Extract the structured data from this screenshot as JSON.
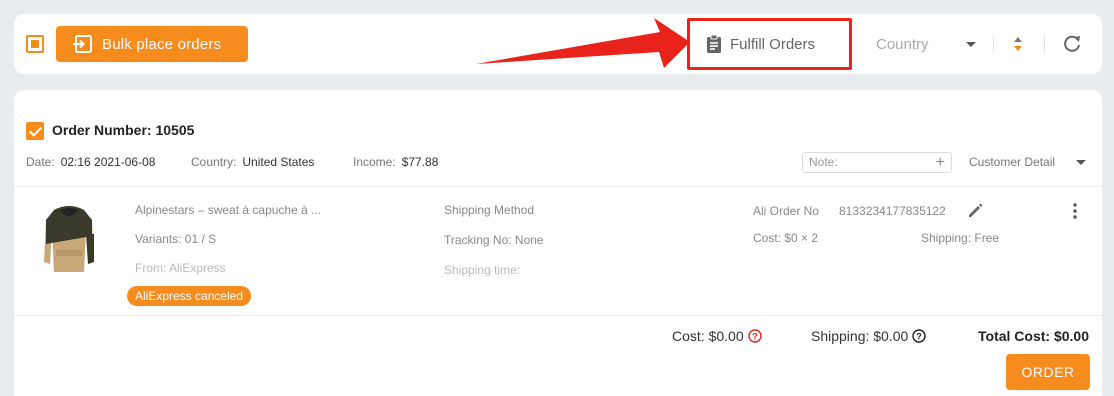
{
  "toolbar": {
    "bulk_label": "Bulk place orders",
    "fulfill_label": "Fulfill Orders",
    "country_placeholder": "Country"
  },
  "order": {
    "number_label": "Order Number: 10505",
    "date_key": "Date:",
    "date_value": "02:16 2021-06-08",
    "country_key": "Country:",
    "country_value": "United States",
    "income_key": "Income:",
    "income_value": "$77.88",
    "note_placeholder": "Note:",
    "customer_detail": "Customer Detail",
    "item": {
      "title": "Alpinestars – sweat à capuche à ...",
      "variants": "Variants: 01 / S",
      "from": "From: AliExpress",
      "status_badge": "AliExpress canceled",
      "shipping_method": "Shipping Method",
      "tracking": "Tracking No: None",
      "shipping_time": "Shipping time:",
      "ali_order_label": "Ali Order No",
      "ali_order_number": "8133234177835122",
      "cost": "Cost: $0 × 2",
      "shipping": "Shipping: Free"
    },
    "summary": {
      "cost": "Cost: $0.00",
      "shipping": "Shipping: $0.00",
      "total": "Total Cost: $0.00"
    },
    "order_button": "ORDER"
  },
  "colors": {
    "accent": "#f68b1e",
    "highlight": "#e8231b"
  }
}
